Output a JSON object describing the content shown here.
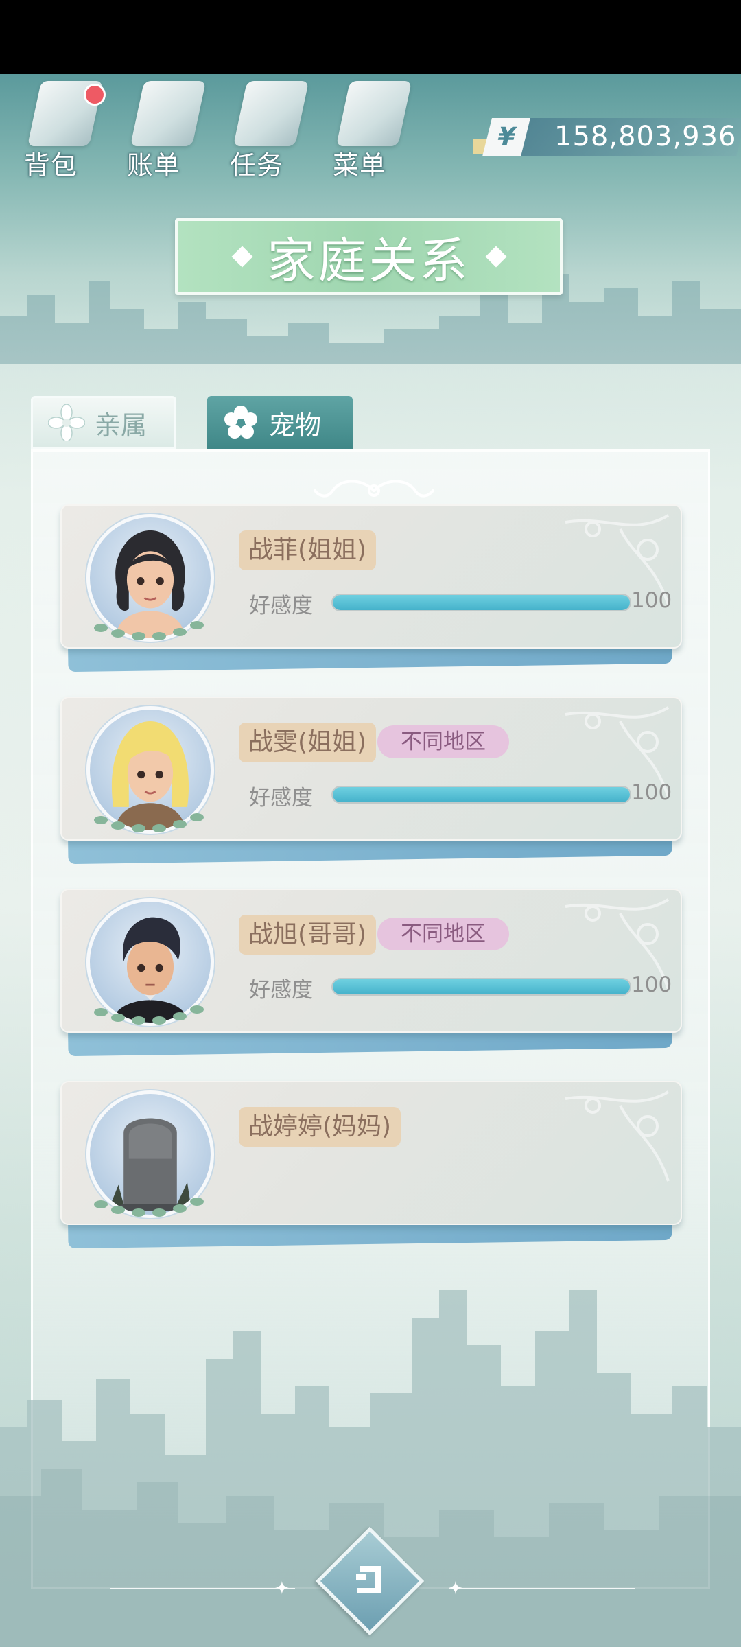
{
  "nav": {
    "items": [
      {
        "label": "背包",
        "icon": "backpack-icon",
        "has_badge": true
      },
      {
        "label": "账单",
        "icon": "bill-icon",
        "has_badge": false
      },
      {
        "label": "任务",
        "icon": "task-icon",
        "has_badge": false
      },
      {
        "label": "菜单",
        "icon": "menu-icon",
        "has_badge": false
      }
    ]
  },
  "money": {
    "currency_symbol": "¥",
    "value": "158,803,936"
  },
  "title": "家庭关系",
  "tabs": [
    {
      "label": "亲属",
      "active": true
    },
    {
      "label": "宠物",
      "active": false
    }
  ],
  "affinity_label": "好感度",
  "members": [
    {
      "name": "战菲(姐姐)",
      "region": "",
      "affinity": 100,
      "affinity_text": "100",
      "avatar": "dark-hair-girl"
    },
    {
      "name": "战雯(姐姐)",
      "region": "不同地区",
      "affinity": 100,
      "affinity_text": "100",
      "avatar": "blonde-girl"
    },
    {
      "name": "战旭(哥哥)",
      "region": "不同地区",
      "affinity": 100,
      "affinity_text": "100",
      "avatar": "dark-hair-boy"
    },
    {
      "name": "战婷婷(妈妈)",
      "region": "",
      "affinity": null,
      "affinity_text": "",
      "avatar": "tombstone"
    }
  ],
  "colors": {
    "accent_green": "#a6dbb5",
    "affinity_fill": "#4fb8cf",
    "name_tag": "#e8d3b6",
    "region_tag": "#e6c4de"
  }
}
